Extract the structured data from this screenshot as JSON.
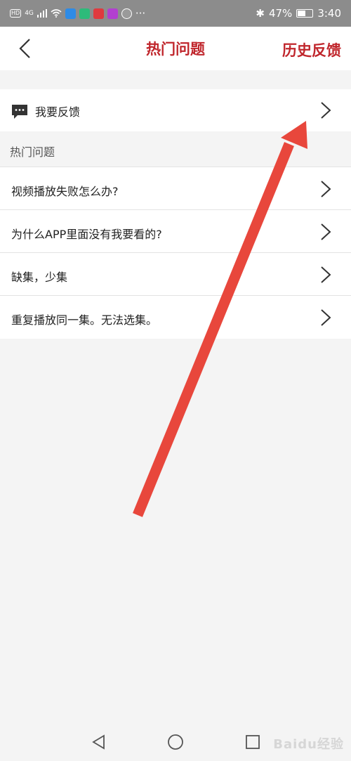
{
  "status_bar": {
    "hd": "HD",
    "network": "4G",
    "bluetooth": "✱",
    "battery_pct": "47%",
    "battery_level": 0.47,
    "time": "3:40",
    "more": "···"
  },
  "header": {
    "title": "热门问题",
    "history_label": "历史反馈"
  },
  "feedback": {
    "label": "我要反馈"
  },
  "section": {
    "title": "热门问题"
  },
  "faq_items": [
    {
      "text": "视频播放失败怎么办?"
    },
    {
      "text": "为什么APP里面没有我要看的?"
    },
    {
      "text": "缺集，少集"
    },
    {
      "text": "重复播放同一集。无法选集。"
    }
  ],
  "watermark": {
    "text": "Baidu经验"
  },
  "colors": {
    "accent": "#c0262c",
    "annotation": "#e8473c"
  }
}
